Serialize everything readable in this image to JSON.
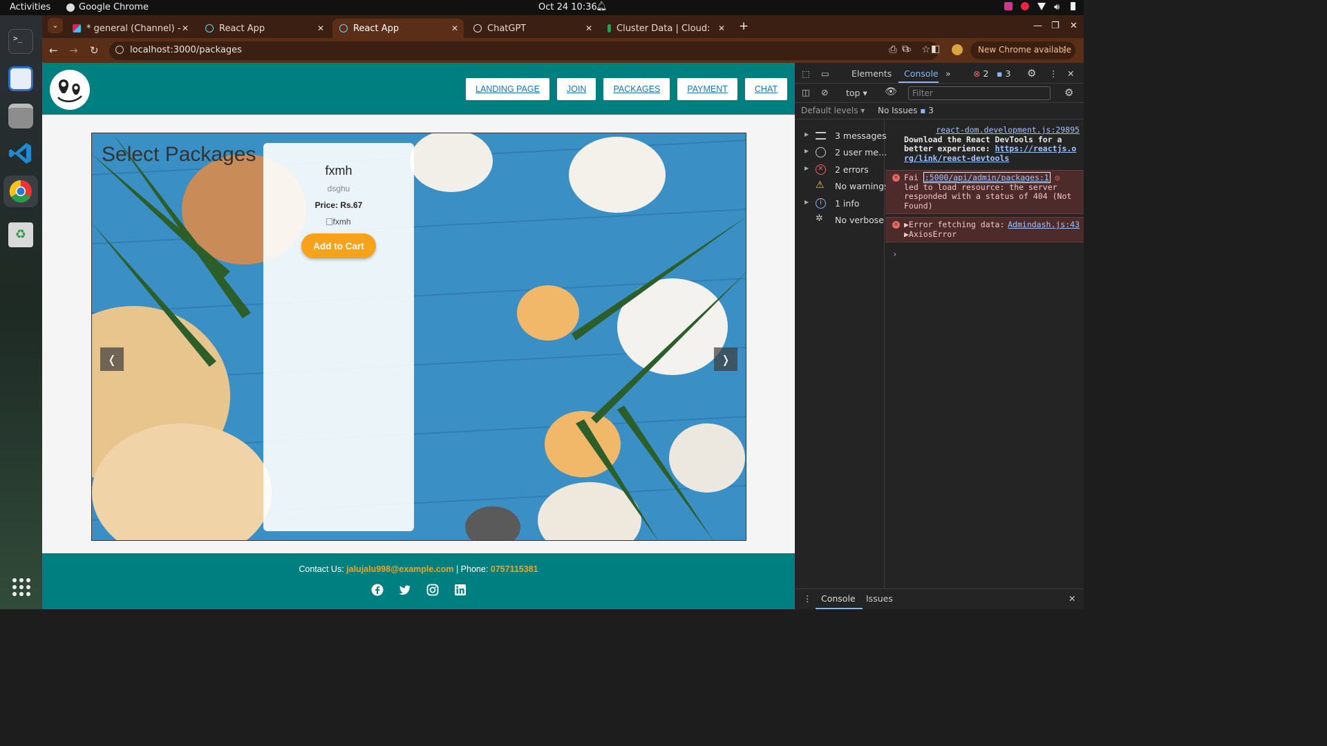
{
  "system": {
    "activities": "Activities",
    "app_name": "Google Chrome",
    "clock": "Oct 24  10:36"
  },
  "tabs": [
    {
      "title": "* general (Channel) - Uki",
      "active": false
    },
    {
      "title": "React App",
      "active": false
    },
    {
      "title": "React App",
      "active": true
    },
    {
      "title": "ChatGPT",
      "active": false
    },
    {
      "title": "Cluster Data | Cloud: Mo",
      "active": false
    }
  ],
  "toolbar": {
    "url": "localhost:3000/packages",
    "new_chrome": "New Chrome available"
  },
  "site": {
    "nav": [
      "LANDING PAGE",
      "JOIN",
      "PACKAGES",
      "PAYMENT",
      "CHAT"
    ],
    "heading": "Select Packages",
    "card": {
      "name": "fxmh",
      "desc": "dsghu",
      "price": "Price: Rs.67",
      "img_alt": "fxmh",
      "button": "Add to Cart"
    },
    "prev": "❬",
    "next": "❭",
    "footer": {
      "contact_label": "Contact Us: ",
      "email": "jalujalu998@example.com",
      "sep": " | Phone: ",
      "phone": "0757115381"
    }
  },
  "devtools": {
    "tabs": [
      "Elements",
      "Console"
    ],
    "error_count": "2",
    "msg_count": "3",
    "context": "top",
    "filter_placeholder": "Filter",
    "levels": "Default levels ▾",
    "issues": "No Issues",
    "issues_count": "3",
    "sidebar": [
      {
        "label": "3 messages",
        "expandable": true
      },
      {
        "label": "2 user me…",
        "expandable": true
      },
      {
        "label": "2 errors",
        "expandable": true
      },
      {
        "label": "No warnings",
        "expandable": false
      },
      {
        "label": "1 info",
        "expandable": true
      },
      {
        "label": "No verbose",
        "expandable": false
      }
    ],
    "messages": {
      "info_link": "react-dom.development.js:29895",
      "info_text": "Download the React DevTools for a better experience: ",
      "info_url": "https://reactjs.org/link/react-devtools",
      "err1_pre": "Fai",
      "err1_link": ":5000/api/admin/packages:1",
      "err1_text": "led to load resource: the server responded with a status of 404 (Not Found)",
      "err2_text": "▶Error fetching data: ▶AxiosError",
      "err2_link": "Admindash.js:43"
    },
    "bottom_tabs": [
      "Console",
      "Issues"
    ]
  }
}
